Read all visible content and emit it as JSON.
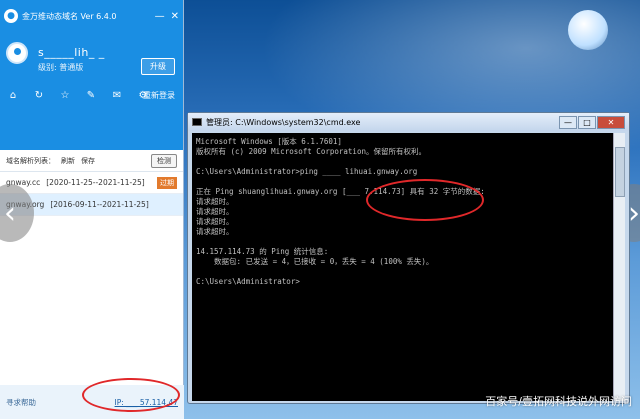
{
  "app": {
    "title": "金万维动态域名 Ver 6.4.0",
    "window_controls": [
      "—",
      "✕"
    ],
    "user": {
      "name": "s_____lih_ _",
      "level_label": "级别: 普通版"
    },
    "upgrade_label": "升级",
    "logout_label": "重新登录",
    "tools": [
      "⌂",
      "↻",
      "☆",
      "✎",
      "✉",
      "⚙"
    ],
    "toolbar": {
      "list_label": "域名解析列表：",
      "refresh_label": "刷新",
      "save_label": "保存",
      "add_label": "检测"
    },
    "domains": [
      {
        "name": "gnway.cc",
        "period": "[2020-11-25--2021-11-25]",
        "badge": "过期"
      },
      {
        "name": "gnway.org",
        "period": "[2016-09-11--2021-11-25]",
        "badge": ""
      }
    ],
    "footer": {
      "help_label": "寻求帮助",
      "ip_label": "IP: ___ 57.114.47"
    }
  },
  "cmd": {
    "title": "管理员: C:\\Windows\\system32\\cmd.exe",
    "controls": [
      "—",
      "□",
      "✕"
    ],
    "lines": [
      "Microsoft Windows [版本 6.1.7601]",
      "版权所有 (c) 2009 Microsoft Corporation。保留所有权利。",
      "",
      "C:\\Users\\Administrator>ping ____ lihuai.gnway.org",
      "",
      "正在 Ping shuanglihuai.gnway.org [___ 7.114.73] 具有 32 字节的数据:",
      "请求超时。",
      "请求超时。",
      "请求超时。",
      "请求超时。",
      "",
      "14.157.114.73 的 Ping 统计信息:",
      "    数据包: 已发送 = 4，已接收 = 0，丢失 = 4 (100% 丢失)。",
      "",
      "C:\\Users\\Administrator>"
    ]
  },
  "nav": {
    "prev": "‹",
    "next": "›"
  },
  "watermark": "百家号/壹拓网科技说外网访问"
}
